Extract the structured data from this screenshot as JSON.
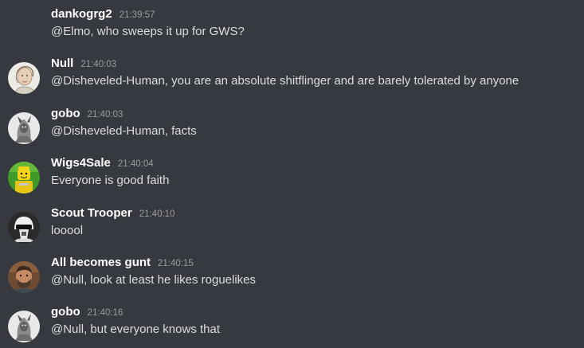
{
  "messages": [
    {
      "author": "dankogrg2",
      "time": "21:39:57",
      "text": "@Elmo, who sweeps it up for GWS?",
      "avatar": "none"
    },
    {
      "author": "Null",
      "time": "21:40:03",
      "text": "@Disheveled-Human, you are an absolute shitflinger and are barely tolerated by anyone",
      "avatar": "sketch-portrait-avatar"
    },
    {
      "author": "gobo",
      "time": "21:40:03",
      "text": "@Disheveled-Human, facts",
      "avatar": "creature-avatar"
    },
    {
      "author": "Wigs4Sale",
      "time": "21:40:04",
      "text": "Everyone is good faith",
      "avatar": "lego-figure-avatar"
    },
    {
      "author": "Scout Trooper",
      "time": "21:40:10",
      "text": "looool",
      "avatar": "scout-trooper-helmet-avatar"
    },
    {
      "author": "All becomes gunt",
      "time": "21:40:15",
      "text": "@Null, look at least he likes roguelikes",
      "avatar": "bearded-man-avatar"
    },
    {
      "author": "gobo",
      "time": "21:40:16",
      "text": "@Null, but everyone knows that",
      "avatar": "creature-avatar"
    }
  ],
  "colors": {
    "background": "#36393f",
    "username": "#ffffff",
    "timestamp": "#9a9ca2",
    "message_text": "#dcddde"
  }
}
